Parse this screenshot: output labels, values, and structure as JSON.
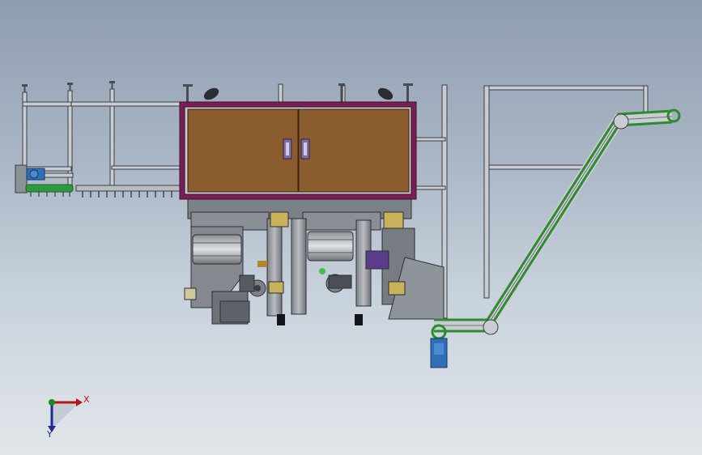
{
  "viewport": {
    "background_top": "#8e9db0",
    "background_bottom": "#e2e6ea"
  },
  "model": {
    "cabinet_color": "#8a5a2b",
    "cabinet_border_color": "#7a1f55",
    "frame_color": "#c9cdd2",
    "machine_color": "#9aa0a6",
    "conveyor_belt_color": "#2e8a2e",
    "motor_color": "#2f6fb5"
  },
  "triad": {
    "x_label": "X",
    "y_label": "Y",
    "x_color": "#b01818",
    "y_color": "#1c2a9a",
    "origin_color": "#1a8a1a"
  }
}
